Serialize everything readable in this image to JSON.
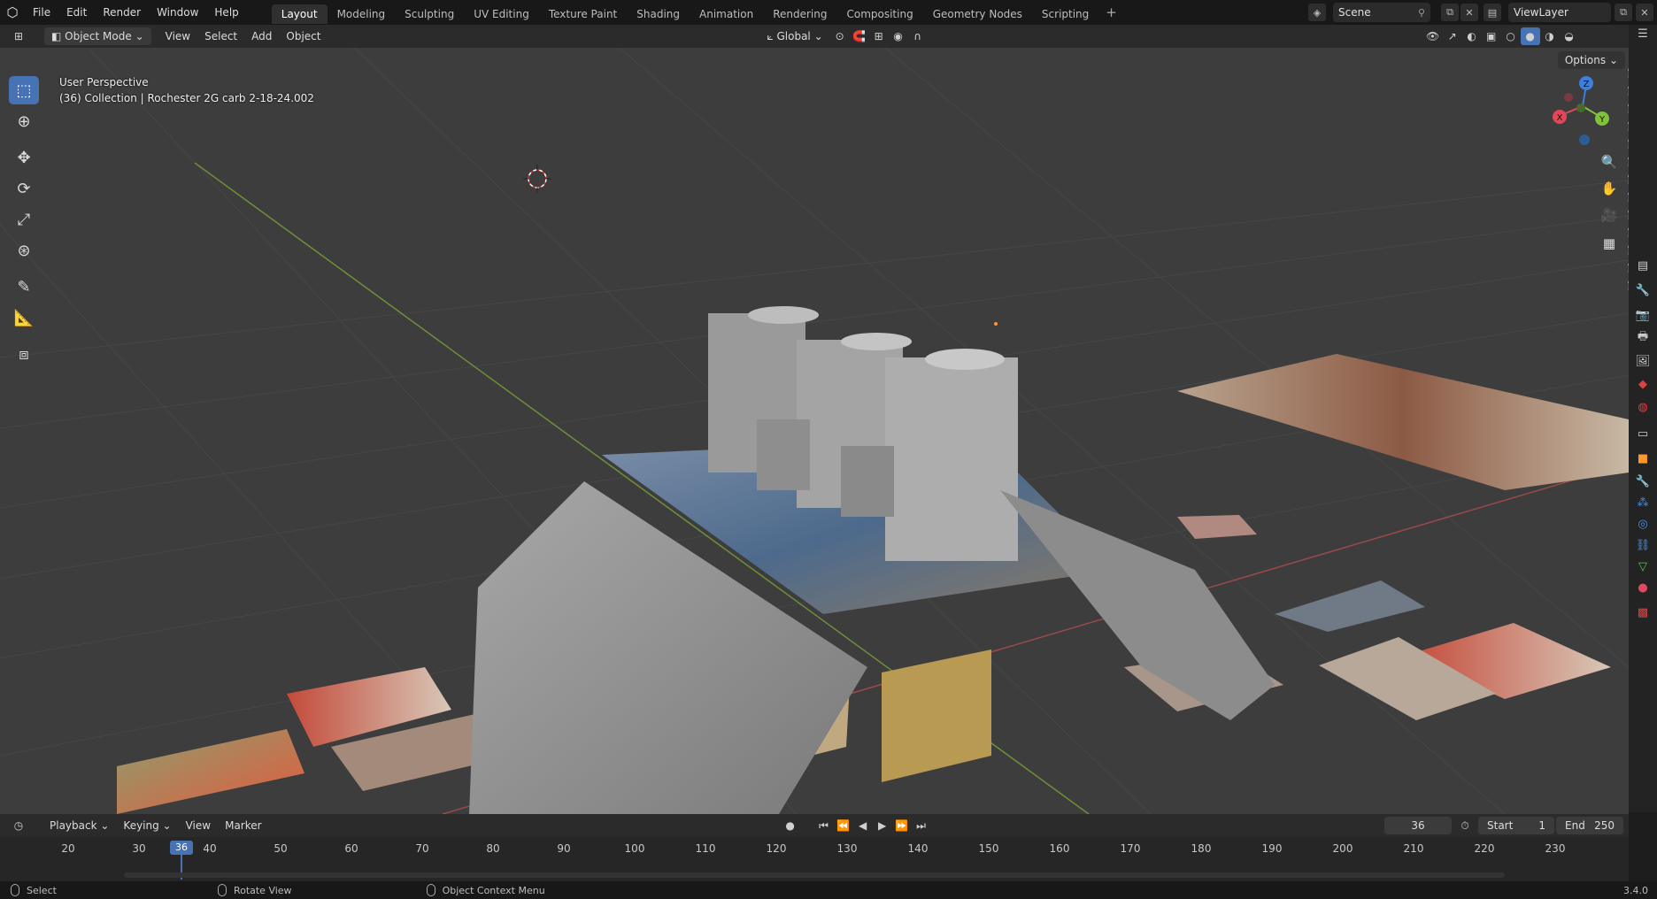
{
  "menu": [
    "File",
    "Edit",
    "Render",
    "Window",
    "Help"
  ],
  "workspaces": [
    "Layout",
    "Modeling",
    "Sculpting",
    "UV Editing",
    "Texture Paint",
    "Shading",
    "Animation",
    "Rendering",
    "Compositing",
    "Geometry Nodes",
    "Scripting"
  ],
  "scene_name": "Scene",
  "view_layer": "ViewLayer",
  "viewport_header": {
    "mode": "Object Mode",
    "menus": [
      "View",
      "Select",
      "Add",
      "Object"
    ],
    "orientation": "Global"
  },
  "overlay": {
    "perspective": "User Perspective",
    "collection_info": "(36) Collection | Rochester 2G carb 2-18-24.002",
    "options_label": "Options"
  },
  "gizmo": {
    "x": "X",
    "y": "Y",
    "z": "Z"
  },
  "timeline": {
    "menus": [
      "Playback",
      "Keying",
      "View",
      "Marker"
    ],
    "current_frame": "36",
    "start_label": "Start",
    "start": "1",
    "end_label": "End",
    "end": "250",
    "ticks": [
      "20",
      "30",
      "40",
      "50",
      "60",
      "70",
      "80",
      "90",
      "100",
      "110",
      "120",
      "130",
      "140",
      "150",
      "160",
      "170",
      "180",
      "190",
      "200",
      "210",
      "220",
      "230"
    ],
    "playhead_label": "36"
  },
  "status": {
    "select": "Select",
    "rotate": "Rotate View",
    "context_menu": "Object Context Menu",
    "version": "3.4.0"
  },
  "colors": {
    "accent": "#4772b3",
    "axis_x": "#e0485a",
    "axis_y": "#80c23a",
    "axis_z": "#3d7fd9"
  }
}
